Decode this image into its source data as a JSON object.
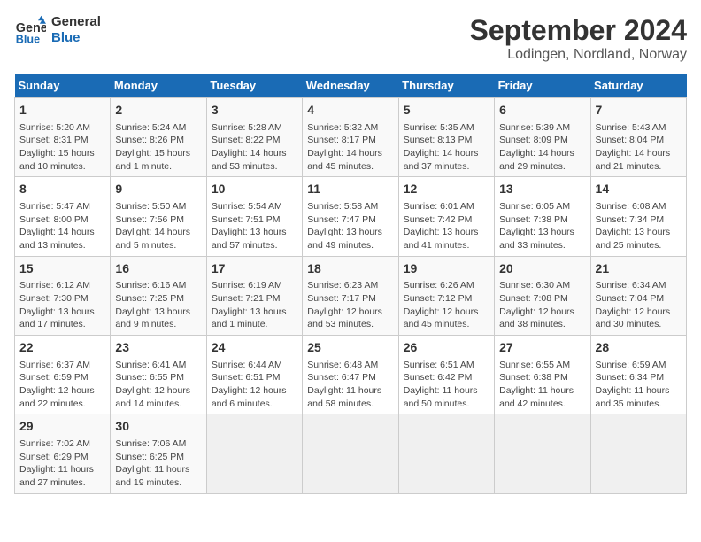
{
  "logo": {
    "line1": "General",
    "line2": "Blue"
  },
  "title": "September 2024",
  "subtitle": "Lodingen, Nordland, Norway",
  "days_of_week": [
    "Sunday",
    "Monday",
    "Tuesday",
    "Wednesday",
    "Thursday",
    "Friday",
    "Saturday"
  ],
  "weeks": [
    [
      {
        "day": "1",
        "lines": [
          "Sunrise: 5:20 AM",
          "Sunset: 8:31 PM",
          "Daylight: 15 hours",
          "and 10 minutes."
        ]
      },
      {
        "day": "2",
        "lines": [
          "Sunrise: 5:24 AM",
          "Sunset: 8:26 PM",
          "Daylight: 15 hours",
          "and 1 minute."
        ]
      },
      {
        "day": "3",
        "lines": [
          "Sunrise: 5:28 AM",
          "Sunset: 8:22 PM",
          "Daylight: 14 hours",
          "and 53 minutes."
        ]
      },
      {
        "day": "4",
        "lines": [
          "Sunrise: 5:32 AM",
          "Sunset: 8:17 PM",
          "Daylight: 14 hours",
          "and 45 minutes."
        ]
      },
      {
        "day": "5",
        "lines": [
          "Sunrise: 5:35 AM",
          "Sunset: 8:13 PM",
          "Daylight: 14 hours",
          "and 37 minutes."
        ]
      },
      {
        "day": "6",
        "lines": [
          "Sunrise: 5:39 AM",
          "Sunset: 8:09 PM",
          "Daylight: 14 hours",
          "and 29 minutes."
        ]
      },
      {
        "day": "7",
        "lines": [
          "Sunrise: 5:43 AM",
          "Sunset: 8:04 PM",
          "Daylight: 14 hours",
          "and 21 minutes."
        ]
      }
    ],
    [
      {
        "day": "8",
        "lines": [
          "Sunrise: 5:47 AM",
          "Sunset: 8:00 PM",
          "Daylight: 14 hours",
          "and 13 minutes."
        ]
      },
      {
        "day": "9",
        "lines": [
          "Sunrise: 5:50 AM",
          "Sunset: 7:56 PM",
          "Daylight: 14 hours",
          "and 5 minutes."
        ]
      },
      {
        "day": "10",
        "lines": [
          "Sunrise: 5:54 AM",
          "Sunset: 7:51 PM",
          "Daylight: 13 hours",
          "and 57 minutes."
        ]
      },
      {
        "day": "11",
        "lines": [
          "Sunrise: 5:58 AM",
          "Sunset: 7:47 PM",
          "Daylight: 13 hours",
          "and 49 minutes."
        ]
      },
      {
        "day": "12",
        "lines": [
          "Sunrise: 6:01 AM",
          "Sunset: 7:42 PM",
          "Daylight: 13 hours",
          "and 41 minutes."
        ]
      },
      {
        "day": "13",
        "lines": [
          "Sunrise: 6:05 AM",
          "Sunset: 7:38 PM",
          "Daylight: 13 hours",
          "and 33 minutes."
        ]
      },
      {
        "day": "14",
        "lines": [
          "Sunrise: 6:08 AM",
          "Sunset: 7:34 PM",
          "Daylight: 13 hours",
          "and 25 minutes."
        ]
      }
    ],
    [
      {
        "day": "15",
        "lines": [
          "Sunrise: 6:12 AM",
          "Sunset: 7:30 PM",
          "Daylight: 13 hours",
          "and 17 minutes."
        ]
      },
      {
        "day": "16",
        "lines": [
          "Sunrise: 6:16 AM",
          "Sunset: 7:25 PM",
          "Daylight: 13 hours",
          "and 9 minutes."
        ]
      },
      {
        "day": "17",
        "lines": [
          "Sunrise: 6:19 AM",
          "Sunset: 7:21 PM",
          "Daylight: 13 hours",
          "and 1 minute."
        ]
      },
      {
        "day": "18",
        "lines": [
          "Sunrise: 6:23 AM",
          "Sunset: 7:17 PM",
          "Daylight: 12 hours",
          "and 53 minutes."
        ]
      },
      {
        "day": "19",
        "lines": [
          "Sunrise: 6:26 AM",
          "Sunset: 7:12 PM",
          "Daylight: 12 hours",
          "and 45 minutes."
        ]
      },
      {
        "day": "20",
        "lines": [
          "Sunrise: 6:30 AM",
          "Sunset: 7:08 PM",
          "Daylight: 12 hours",
          "and 38 minutes."
        ]
      },
      {
        "day": "21",
        "lines": [
          "Sunrise: 6:34 AM",
          "Sunset: 7:04 PM",
          "Daylight: 12 hours",
          "and 30 minutes."
        ]
      }
    ],
    [
      {
        "day": "22",
        "lines": [
          "Sunrise: 6:37 AM",
          "Sunset: 6:59 PM",
          "Daylight: 12 hours",
          "and 22 minutes."
        ]
      },
      {
        "day": "23",
        "lines": [
          "Sunrise: 6:41 AM",
          "Sunset: 6:55 PM",
          "Daylight: 12 hours",
          "and 14 minutes."
        ]
      },
      {
        "day": "24",
        "lines": [
          "Sunrise: 6:44 AM",
          "Sunset: 6:51 PM",
          "Daylight: 12 hours",
          "and 6 minutes."
        ]
      },
      {
        "day": "25",
        "lines": [
          "Sunrise: 6:48 AM",
          "Sunset: 6:47 PM",
          "Daylight: 11 hours",
          "and 58 minutes."
        ]
      },
      {
        "day": "26",
        "lines": [
          "Sunrise: 6:51 AM",
          "Sunset: 6:42 PM",
          "Daylight: 11 hours",
          "and 50 minutes."
        ]
      },
      {
        "day": "27",
        "lines": [
          "Sunrise: 6:55 AM",
          "Sunset: 6:38 PM",
          "Daylight: 11 hours",
          "and 42 minutes."
        ]
      },
      {
        "day": "28",
        "lines": [
          "Sunrise: 6:59 AM",
          "Sunset: 6:34 PM",
          "Daylight: 11 hours",
          "and 35 minutes."
        ]
      }
    ],
    [
      {
        "day": "29",
        "lines": [
          "Sunrise: 7:02 AM",
          "Sunset: 6:29 PM",
          "Daylight: 11 hours",
          "and 27 minutes."
        ]
      },
      {
        "day": "30",
        "lines": [
          "Sunrise: 7:06 AM",
          "Sunset: 6:25 PM",
          "Daylight: 11 hours",
          "and 19 minutes."
        ]
      },
      {
        "day": "",
        "lines": []
      },
      {
        "day": "",
        "lines": []
      },
      {
        "day": "",
        "lines": []
      },
      {
        "day": "",
        "lines": []
      },
      {
        "day": "",
        "lines": []
      }
    ]
  ]
}
